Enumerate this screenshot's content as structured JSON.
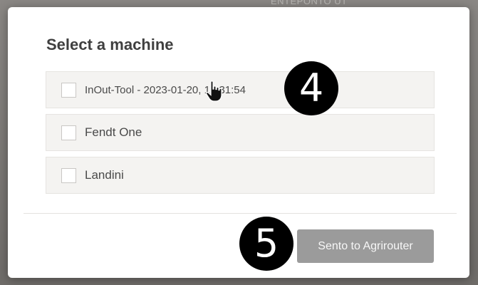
{
  "backdrop": {
    "hint_text": "ENTEPONTO UT"
  },
  "dialog": {
    "title": "Select a machine",
    "machines": [
      {
        "label": "InOut-Tool - 2023-01-20, 16:31:54",
        "checked": false
      },
      {
        "label": "Fendt One",
        "checked": false
      },
      {
        "label": "Landini",
        "checked": false
      }
    ],
    "send_button_label": "Sento to Agrirouter"
  },
  "annotations": {
    "step_4": "4",
    "step_5": "5"
  },
  "icons": {
    "cursor": "hand-pointer-icon",
    "checkbox": "checkbox-unchecked-icon"
  },
  "colors": {
    "modal_background": "#ffffff",
    "item_background": "#f4f3f1",
    "button_background": "#9b9b9b",
    "button_text": "#f7f7f7",
    "title_text": "#3f3f3f",
    "badge_background": "#000000"
  }
}
